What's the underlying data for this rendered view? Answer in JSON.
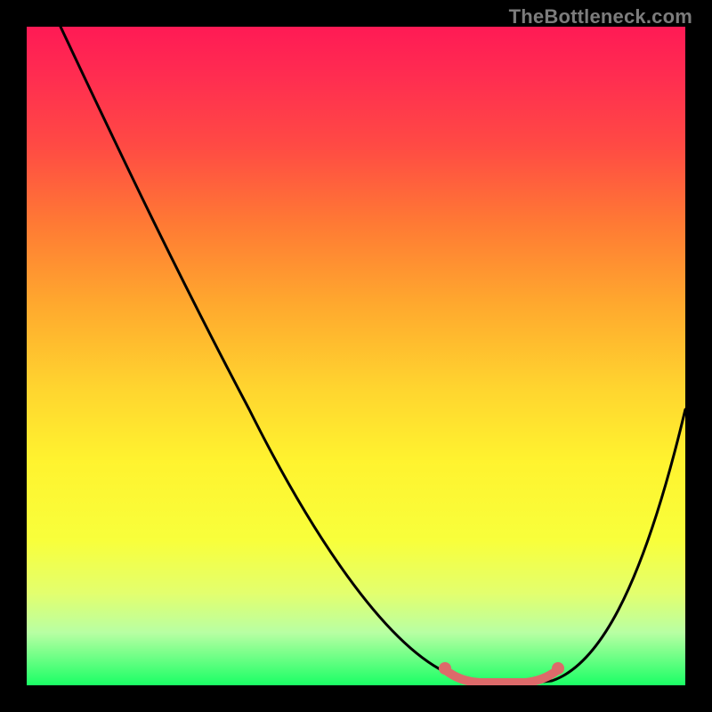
{
  "attribution": "TheBottleneck.com",
  "chart_data": {
    "type": "line",
    "title": "",
    "xlabel": "",
    "ylabel": "",
    "xlim": [
      0,
      100
    ],
    "ylim": [
      0,
      100
    ],
    "series": [
      {
        "name": "bottleneck-curve",
        "x": [
          5,
          10,
          15,
          20,
          25,
          30,
          35,
          40,
          45,
          50,
          55,
          60,
          65,
          70,
          75,
          80,
          85,
          90,
          95,
          100
        ],
        "values": [
          100,
          92,
          84,
          76,
          68,
          60,
          52,
          44,
          36,
          28,
          20,
          12,
          5,
          1,
          0,
          0,
          2,
          10,
          25,
          42
        ]
      }
    ],
    "highlight": {
      "name": "optimal-range",
      "x_range": [
        66,
        82
      ],
      "value": 0
    }
  }
}
